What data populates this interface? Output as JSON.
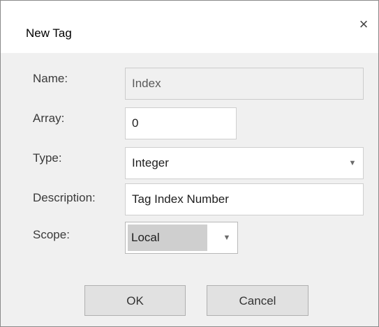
{
  "dialog": {
    "title": "New Tag",
    "close_glyph": "×"
  },
  "form": {
    "name": {
      "label": "Name:",
      "value": "Index"
    },
    "array": {
      "label": "Array:",
      "value": "0"
    },
    "type": {
      "label": "Type:",
      "value": "Integer",
      "arrow": "▼"
    },
    "description": {
      "label": "Description:",
      "value": "Tag Index Number"
    },
    "scope": {
      "label": "Scope:",
      "value": "Local",
      "arrow": "▼"
    }
  },
  "buttons": {
    "ok_label": "OK",
    "cancel_label": "Cancel"
  },
  "icons": {
    "close": "close-icon",
    "dropdown": "chevron-down-icon"
  },
  "colors": {
    "titlebar_bg": "#ffffff",
    "body_bg": "#f0f0f0",
    "button_bg": "#e1e1e1",
    "scope_highlight": "#cfcfcf"
  }
}
